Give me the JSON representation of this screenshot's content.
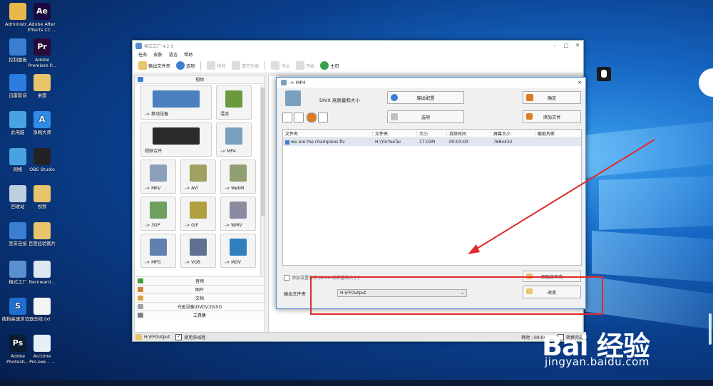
{
  "desktop": {
    "icons": [
      {
        "label": "Administr...",
        "color": "#e8b84a",
        "glyph": "",
        "icon": "user-folder-icon"
      },
      {
        "label": "Adobe After Effects CC ...",
        "color": "#1a0a44",
        "glyph": "Ae",
        "icon": "after-effects-icon"
      },
      {
        "label": "控制面板",
        "color": "#3b7fd3",
        "glyph": "",
        "icon": "control-panel-icon"
      },
      {
        "label": "Adobe Premiere P...",
        "color": "#2a0a3a",
        "glyph": "Pr",
        "icon": "premiere-icon"
      },
      {
        "label": "迅雷影音",
        "color": "#2b7de0",
        "glyph": "",
        "icon": "xunlei-player-icon"
      },
      {
        "label": "桌面",
        "color": "#e8c46a",
        "glyph": "",
        "icon": "folder-icon"
      },
      {
        "label": "此电脑",
        "color": "#4aa3e0",
        "glyph": "",
        "icon": "computer-icon"
      },
      {
        "label": "净网大师",
        "color": "#2e8be6",
        "glyph": "A",
        "icon": "netclean-icon"
      },
      {
        "label": "网络",
        "color": "#4aa3e0",
        "glyph": "",
        "icon": "network-icon"
      },
      {
        "label": "OBS Studio",
        "color": "#222",
        "glyph": "",
        "icon": "obs-icon"
      },
      {
        "label": "回收站",
        "color": "#bcd0e0",
        "glyph": "",
        "icon": "recycle-bin-icon"
      },
      {
        "label": "视频",
        "color": "#e8c46a",
        "glyph": "",
        "icon": "folder-icon"
      },
      {
        "label": "宽带连接",
        "color": "#3b7fd3",
        "glyph": "",
        "icon": "broadband-icon"
      },
      {
        "label": "百度经验图片",
        "color": "#e8c46a",
        "glyph": "",
        "icon": "folder-icon"
      },
      {
        "label": "格式工厂",
        "color": "#5a8fd0",
        "glyph": "",
        "icon": "format-factory-icon"
      },
      {
        "label": "Bernward...",
        "color": "#dfe8f0",
        "glyph": "",
        "icon": "bernward-icon"
      },
      {
        "label": "搜狗高速浏览器",
        "color": "#1e6fd0",
        "glyph": "S",
        "icon": "sogou-browser-icon"
      },
      {
        "label": "总结.txt",
        "color": "#f4f4f4",
        "glyph": "",
        "icon": "text-file-icon"
      },
      {
        "label": "Adobe Photosh...",
        "color": "#0a1c33",
        "glyph": "Ps",
        "icon": "photoshop-icon"
      },
      {
        "label": "Arctime Pro.exe - ...",
        "color": "#e6eef6",
        "glyph": "",
        "icon": "arctime-icon"
      }
    ]
  },
  "app": {
    "title": "格式工厂 4.2.0",
    "menu": [
      "任务",
      "皮肤",
      "语言",
      "帮助"
    ],
    "toolbar": {
      "output_folder": "输出文件夹",
      "options": "选项",
      "remove": "移除",
      "clear_list": "清空列表",
      "stop": "停止",
      "start": "开始",
      "home": "主页"
    },
    "category_video": "视频",
    "tiles": [
      {
        "label": "-> 移动设备",
        "color": "#4a7fc0"
      },
      {
        "label": "混流",
        "color": "#6a9a40"
      },
      {
        "label": "视频合并",
        "color": "#2a2a2a"
      },
      {
        "label": "-> MP4",
        "color": "#7aa0c0"
      },
      {
        "label": "-> MKV",
        "color": "#8aa0b8"
      },
      {
        "label": "-> AVI",
        "color": "#a0a060"
      },
      {
        "label": "-> WebM",
        "color": "#90a070"
      },
      {
        "label": "-> 3GP",
        "color": "#70a060"
      },
      {
        "label": "-> GIF",
        "color": "#b0a040"
      },
      {
        "label": "-> WMV",
        "color": "#8a8aa0"
      },
      {
        "label": "-> MPG",
        "color": "#6080b0"
      },
      {
        "label": "-> VOB",
        "color": "#607090"
      },
      {
        "label": "-> MOV",
        "color": "#3080c0"
      }
    ],
    "categories": [
      {
        "label": "音频",
        "color": "#40a040"
      },
      {
        "label": "图片",
        "color": "#d08030"
      },
      {
        "label": "文档",
        "color": "#e0a040"
      },
      {
        "label": "光驱设备\\DVD\\CD\\ISO",
        "color": "#a0a0a0"
      },
      {
        "label": "工具集",
        "color": "#808080"
      }
    ],
    "status": {
      "path": "H:\\FFOutput",
      "multithread": "使用多线程",
      "elapsed_label": "耗时 : 00:00:00",
      "shutdown_label": "转换完成"
    }
  },
  "dialog": {
    "title": "-> MP4",
    "quality": "DIVX 高质量和大小",
    "output_config": "输出配置",
    "ok": "确定",
    "options": "选项",
    "add_file": "添加文件",
    "columns": [
      "文件名",
      "文件夹",
      "大小",
      "持续时间",
      "屏幕大小",
      "截取片断"
    ],
    "rows": [
      {
        "name": "we are the champions.flv",
        "folder": "H:\\YinYueTai",
        "size": "17.03M",
        "duration": "00:03:03",
        "screen": "768x432",
        "clip": ""
      }
    ],
    "append_setting": "添加设置名称 [DIVX 高质量和大小]",
    "add_folder": "添加文件夹",
    "output_folder_label": "输出文件夹",
    "output_folder_value": "H:\\FFOutput",
    "change": "改变"
  },
  "watermark": {
    "logo": "Bai 经验",
    "url": "jingyan.baidu.com"
  },
  "colors": {
    "accent_red": "#e12a2a",
    "selection": "#dfe6f2",
    "dialog_border": "#4a90d9"
  }
}
